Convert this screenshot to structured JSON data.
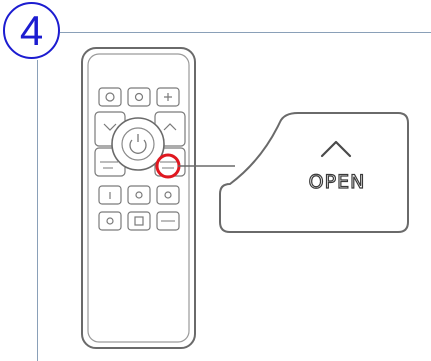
{
  "step": {
    "number": "4"
  },
  "callout": {
    "label": "OPEN"
  },
  "colors": {
    "step_blue": "#1c1cd0",
    "highlight_red": "#e01820",
    "rule": "#8aa0b8",
    "outline": "#6a6a6a"
  },
  "icons": [
    "remote-control-icon",
    "chevron-up-icon",
    "power-icon"
  ]
}
